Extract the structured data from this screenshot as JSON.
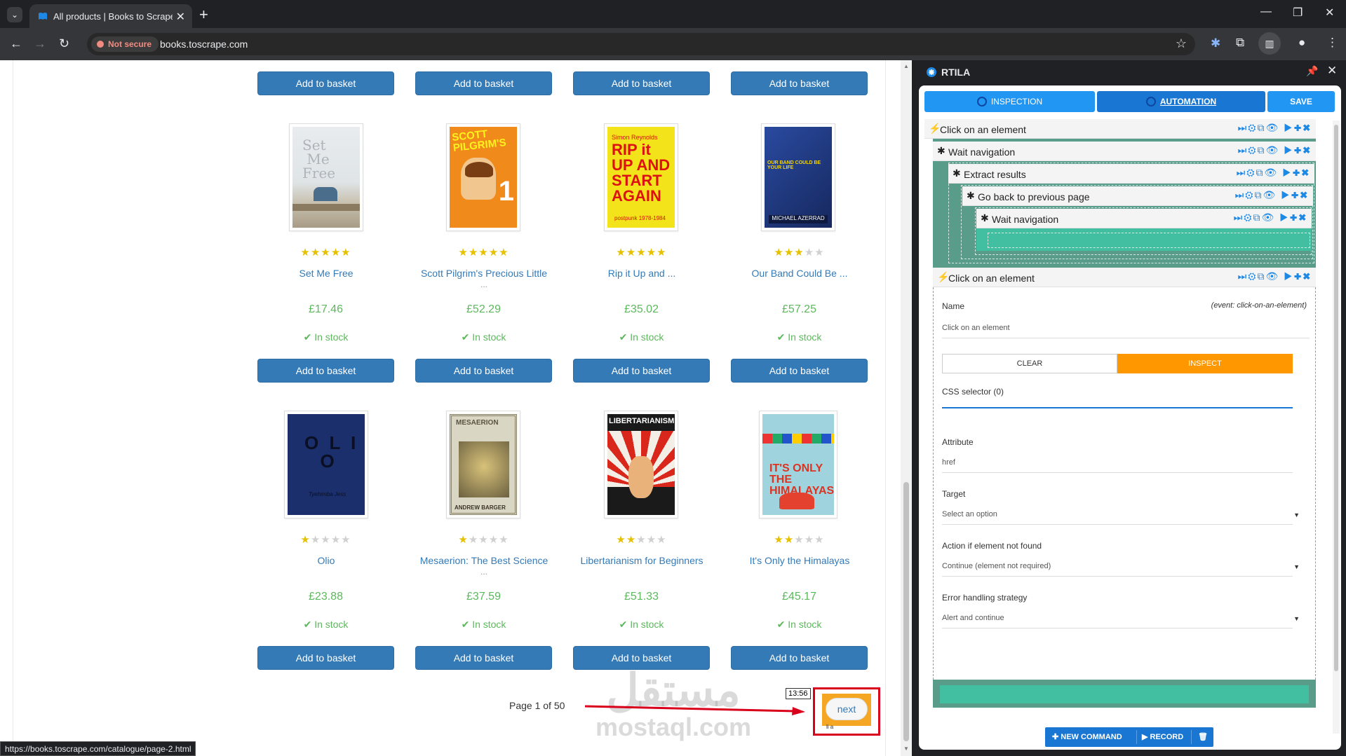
{
  "browser": {
    "tab_title": "All products | Books to Scrape",
    "new_tab": "+",
    "close_tab": "✕",
    "url": "books.toscrape.com",
    "security_label": "Not secure",
    "status_url": "https://books.toscrape.com/catalogue/page-2.html",
    "window_controls": {
      "minimize": "—",
      "restore": "❐",
      "close": "✕"
    }
  },
  "page": {
    "basket_label": "Add to basket",
    "top_row_buttons": 4,
    "books": [
      {
        "title": "Set Me Free",
        "title_more": "",
        "price": "£17.46",
        "stock": "In stock",
        "rating": 5,
        "cover_color": "#dfe4e6"
      },
      {
        "title": "Scott Pilgrim's Precious Little",
        "title_more": "...",
        "price": "£52.29",
        "stock": "In stock",
        "rating": 5,
        "cover_color": "#f08a1a"
      },
      {
        "title": "Rip it Up and ...",
        "title_more": "",
        "price": "£35.02",
        "stock": "In stock",
        "rating": 5,
        "cover_color": "#f3e31b"
      },
      {
        "title": "Our Band Could Be ...",
        "title_more": "",
        "price": "£57.25",
        "stock": "In stock",
        "rating": 3,
        "cover_color": "#233d8a"
      },
      {
        "title": "Olio",
        "title_more": "",
        "price": "£23.88",
        "stock": "In stock",
        "rating": 1,
        "cover_color": "#1a2f6b"
      },
      {
        "title": "Mesaerion: The Best Science",
        "title_more": "...",
        "price": "£37.59",
        "stock": "In stock",
        "rating": 1,
        "cover_color": "#cdc9b3"
      },
      {
        "title": "Libertarianism for Beginners",
        "title_more": "",
        "price": "£51.33",
        "stock": "In stock",
        "rating": 2,
        "cover_color": "#1a1a1a"
      },
      {
        "title": "It's Only the Himalayas",
        "title_more": "",
        "price": "£45.17",
        "stock": "In stock",
        "rating": 2,
        "cover_color": "#9fd4de"
      }
    ],
    "pager_text": "Page 1 of 50",
    "next_label": "next",
    "next_sub": "li a",
    "tooltip_time": "13:56",
    "watermark_ar": "مستقل",
    "watermark_en": "mostaql.com"
  },
  "panel": {
    "title": "RTILA",
    "tabs": {
      "inspection": "INSPECTION",
      "automation": "AUTOMATION",
      "save": "SAVE"
    },
    "commands": [
      {
        "label": "Click on an element",
        "icon": "⚡",
        "level": 0
      },
      {
        "label": "Wait navigation",
        "icon": "✱",
        "level": 1
      },
      {
        "label": "Extract results",
        "icon": "✱",
        "level": 2
      },
      {
        "label": "Go back to previous page",
        "icon": "✱",
        "level": 3
      },
      {
        "label": "Wait navigation",
        "icon": "✱",
        "level": 4
      },
      {
        "label": "Click on an element",
        "icon": "⚡",
        "level": 1
      }
    ],
    "form": {
      "name_label": "Name",
      "event_text": "(event:  click-on-an-element)",
      "name_value": "Click on an element",
      "clear_label": "CLEAR",
      "inspect_label": "INSPECT",
      "css_label": "CSS selector (0)",
      "attribute_label": "Attribute",
      "attribute_value": "href",
      "target_label": "Target",
      "target_value": "Select an option",
      "notfound_label": "Action if element not found",
      "notfound_value": "Continue (element not required)",
      "error_label": "Error handling strategy",
      "error_value": "Alert and continue"
    },
    "bottom": {
      "new_command": "NEW COMMAND",
      "record": "RECORD"
    }
  },
  "colors": {
    "accent": "#337ab7",
    "price": "#5cb85c",
    "panel_blue": "#2196f3",
    "inspect": "#ff9800",
    "teal": "#42bfa0",
    "highlight": "#d9001b"
  }
}
